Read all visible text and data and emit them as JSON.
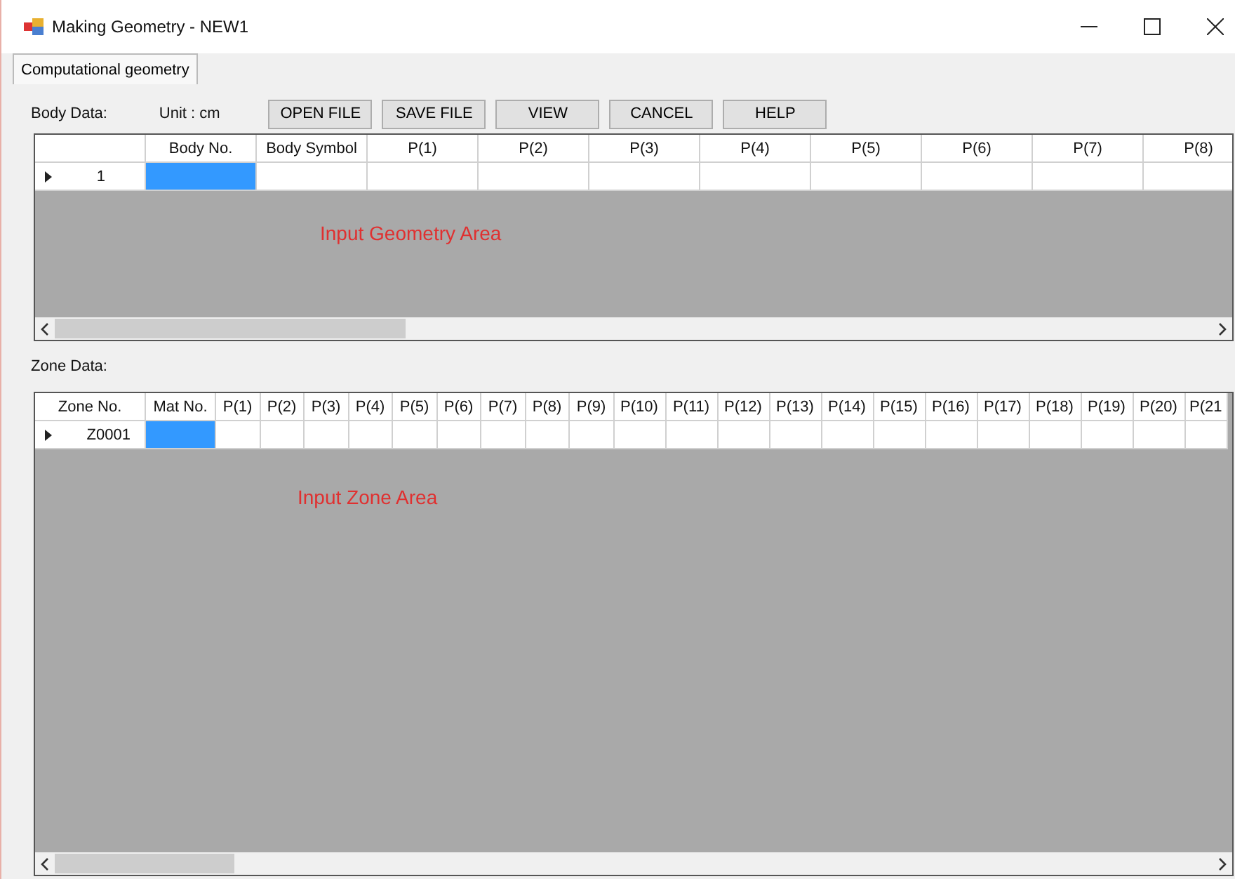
{
  "window": {
    "title": "Making Geometry - NEW1"
  },
  "tabs": [
    {
      "label": "Computational geometry",
      "selected": true
    }
  ],
  "body_data": {
    "label": "Body Data:",
    "unit": "Unit : cm",
    "buttons": [
      "OPEN FILE",
      "SAVE FILE",
      "VIEW",
      "CANCEL",
      "HELP"
    ],
    "columns": [
      "Body No.",
      "Body Symbol",
      "P(1)",
      "P(2)",
      "P(3)",
      "P(4)",
      "P(5)",
      "P(6)",
      "P(7)",
      "P(8)"
    ],
    "rows": [
      {
        "header": "1",
        "current": true,
        "cells": [
          {
            "selected": true
          },
          {
            "selected": false
          },
          {
            "selected": false
          },
          {
            "selected": false
          },
          {
            "selected": false
          },
          {
            "selected": false
          },
          {
            "selected": false
          },
          {
            "selected": false
          },
          {
            "selected": false
          },
          {
            "selected": false
          }
        ]
      }
    ],
    "area_label": "Input Geometry Area"
  },
  "zone_data": {
    "label": "Zone Data:",
    "corner": "Zone No.",
    "columns": [
      "Mat No.",
      "P(1)",
      "P(2)",
      "P(3)",
      "P(4)",
      "P(5)",
      "P(6)",
      "P(7)",
      "P(8)",
      "P(9)",
      "P(10)",
      "P(11)",
      "P(12)",
      "P(13)",
      "P(14)",
      "P(15)",
      "P(16)",
      "P(17)",
      "P(18)",
      "P(19)",
      "P(20)",
      "P(21"
    ],
    "rows": [
      {
        "header": "Z0001",
        "current": true,
        "cells": [
          {
            "selected": true
          },
          {
            "selected": false
          },
          {
            "selected": false
          },
          {
            "selected": false
          },
          {
            "selected": false
          },
          {
            "selected": false
          },
          {
            "selected": false
          },
          {
            "selected": false
          },
          {
            "selected": false
          },
          {
            "selected": false
          },
          {
            "selected": false
          },
          {
            "selected": false
          },
          {
            "selected": false
          },
          {
            "selected": false
          },
          {
            "selected": false
          },
          {
            "selected": false
          },
          {
            "selected": false
          },
          {
            "selected": false
          },
          {
            "selected": false
          },
          {
            "selected": false
          },
          {
            "selected": false
          },
          {
            "selected": false
          }
        ]
      }
    ],
    "area_label": "Input  Zone Area"
  }
}
